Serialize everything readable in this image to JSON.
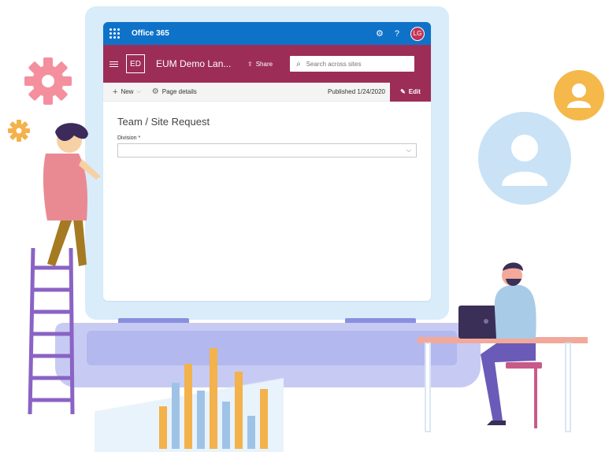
{
  "suite_bar": {
    "title": "Office 365",
    "avatar_initials": "LG"
  },
  "site_header": {
    "logo": "ED",
    "site_name": "EUM Demo Lan...",
    "share_label": "Share",
    "search_placeholder": "Search across sites"
  },
  "command_bar": {
    "new_label": "New",
    "page_details_label": "Page details",
    "published_text": "Published 1/24/2020",
    "edit_label": "Edit"
  },
  "page": {
    "title": "Team / Site Request",
    "division_label": "Division *",
    "division_value": ""
  },
  "colors": {
    "suite_bar": "#0f72c9",
    "site_header": "#9c2d56",
    "edit_button": "#9c2d56",
    "avatar": "#c13455"
  },
  "icons": [
    "waffle-icon",
    "settings-icon",
    "help-icon",
    "hamburger-icon",
    "share-icon",
    "search-icon",
    "plus-icon",
    "gear-icon",
    "pencil-icon",
    "chevron-down-icon"
  ]
}
